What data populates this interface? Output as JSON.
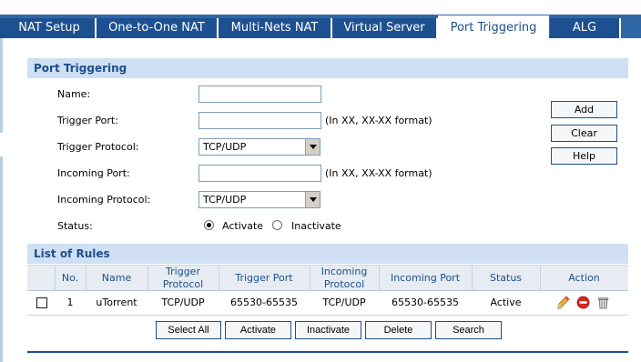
{
  "tabs": [
    {
      "label": "NAT Setup"
    },
    {
      "label": "One-to-One NAT"
    },
    {
      "label": "Multi-Nets NAT"
    },
    {
      "label": "Virtual Server"
    },
    {
      "label": "Port Triggering"
    },
    {
      "label": "ALG"
    }
  ],
  "active_tab": "Port Triggering",
  "form": {
    "title": "Port Triggering",
    "name_label": "Name:",
    "name_value": "",
    "trigger_port_label": "Trigger Port:",
    "trigger_port_value": "",
    "trigger_port_hint": "(In XX, XX-XX format)",
    "trigger_protocol_label": "Trigger Protocol:",
    "trigger_protocol_value": "TCP/UDP",
    "incoming_port_label": "Incoming Port:",
    "incoming_port_value": "",
    "incoming_port_hint": "(In XX, XX-XX format)",
    "incoming_protocol_label": "Incoming Protocol:",
    "incoming_protocol_value": "TCP/UDP",
    "status_label": "Status:",
    "status_activate": "Activate",
    "status_inactivate": "Inactivate",
    "status_selected": "Activate"
  },
  "side_buttons": {
    "add": "Add",
    "clear": "Clear",
    "help": "Help"
  },
  "rules": {
    "title": "List of Rules",
    "columns": {
      "no": "No.",
      "name": "Name",
      "trigger_protocol_line1": "Trigger",
      "trigger_protocol_line2": "Protocol",
      "trigger_port": "Trigger Port",
      "incoming_protocol_line1": "Incoming",
      "incoming_protocol_line2": "Protocol",
      "incoming_port": "Incoming Port",
      "status": "Status",
      "action": "Action"
    },
    "rows": [
      {
        "no": "1",
        "name": "uTorrent",
        "trigger_protocol": "TCP/UDP",
        "trigger_port": "65530-65535",
        "incoming_protocol": "TCP/UDP",
        "incoming_port": "65530-65535",
        "status": "Active",
        "selected": false,
        "actions": [
          "edit-pencil-icon",
          "disable-icon",
          "delete-trash-icon"
        ]
      }
    ]
  },
  "bottom_buttons": {
    "select_all": "Select All",
    "activate": "Activate",
    "inactivate": "Inactivate",
    "delete": "Delete",
    "search": "Search"
  },
  "colors": {
    "tabbar": "#2f67a6",
    "tab": "#1d5090",
    "section_header_bg": "#cfe0f4",
    "accent_text": "#1d4f8b"
  }
}
